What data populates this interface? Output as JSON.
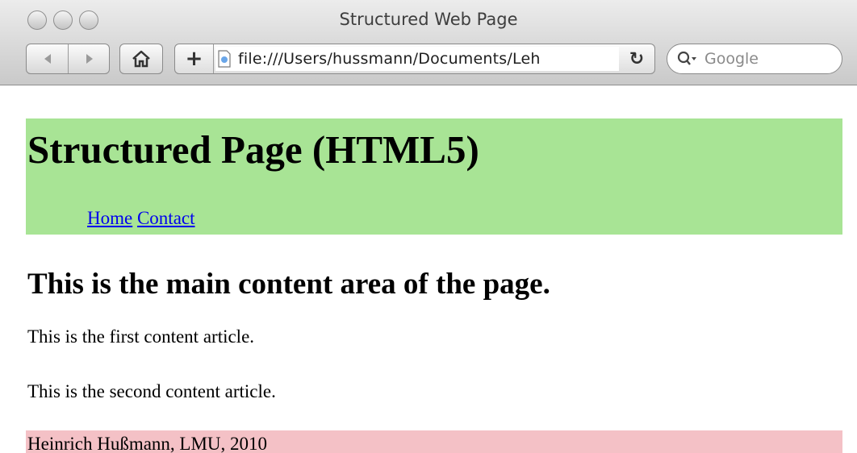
{
  "window": {
    "title": "Structured Web Page"
  },
  "toolbar": {
    "back_icon": "back-arrow-icon",
    "forward_icon": "forward-arrow-icon",
    "home_icon": "home-icon",
    "add_icon": "plus-icon",
    "reload_icon": "reload-icon",
    "url": "file:///Users/hussmann/Documents/Leh",
    "search_placeholder": "Google"
  },
  "page": {
    "colors": {
      "header_bg": "#a8e495",
      "footer_bg": "#f4c1c6",
      "link": "#0000ee"
    },
    "header": {
      "title": "Structured Page (HTML5)",
      "nav": [
        {
          "label": "Home"
        },
        {
          "label": "Contact"
        }
      ]
    },
    "main": {
      "heading": "This is the main content area of the page.",
      "articles": [
        {
          "text": "This is the first content article."
        },
        {
          "text": "This is the second content article."
        }
      ]
    },
    "footer": {
      "text": "Heinrich Hußmann, LMU, 2010"
    }
  }
}
